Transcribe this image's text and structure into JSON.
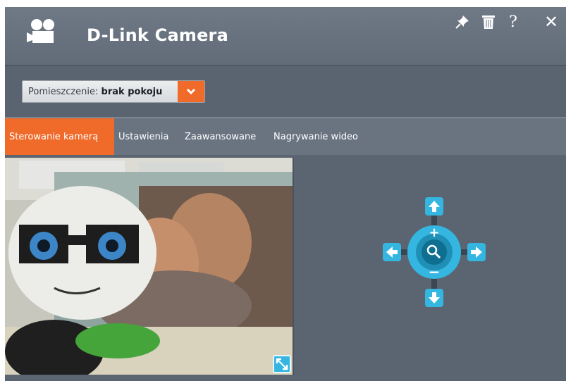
{
  "app": {
    "title": "D-Link Camera"
  },
  "header_icons": [
    "video-camera-icon",
    "pin-icon",
    "trash-icon",
    "help-icon",
    "close-icon"
  ],
  "header": {
    "help_label": "?",
    "close_label": "✕"
  },
  "room": {
    "label": "Pomieszczenie:",
    "value": "brak pokoju"
  },
  "tabs": [
    {
      "label": "Sterowanie kamerą",
      "active": true
    },
    {
      "label": "Ustawienia",
      "active": false
    },
    {
      "label": "Zaawansowane",
      "active": false
    },
    {
      "label": "Nagrywanie wideo",
      "active": false
    }
  ],
  "ptz": {
    "zoom_in": "+",
    "zoom_out": "−"
  },
  "colors": {
    "accent": "#f06a2a",
    "control_blue": "#34b6e0",
    "window_bg": "#5d6774"
  }
}
